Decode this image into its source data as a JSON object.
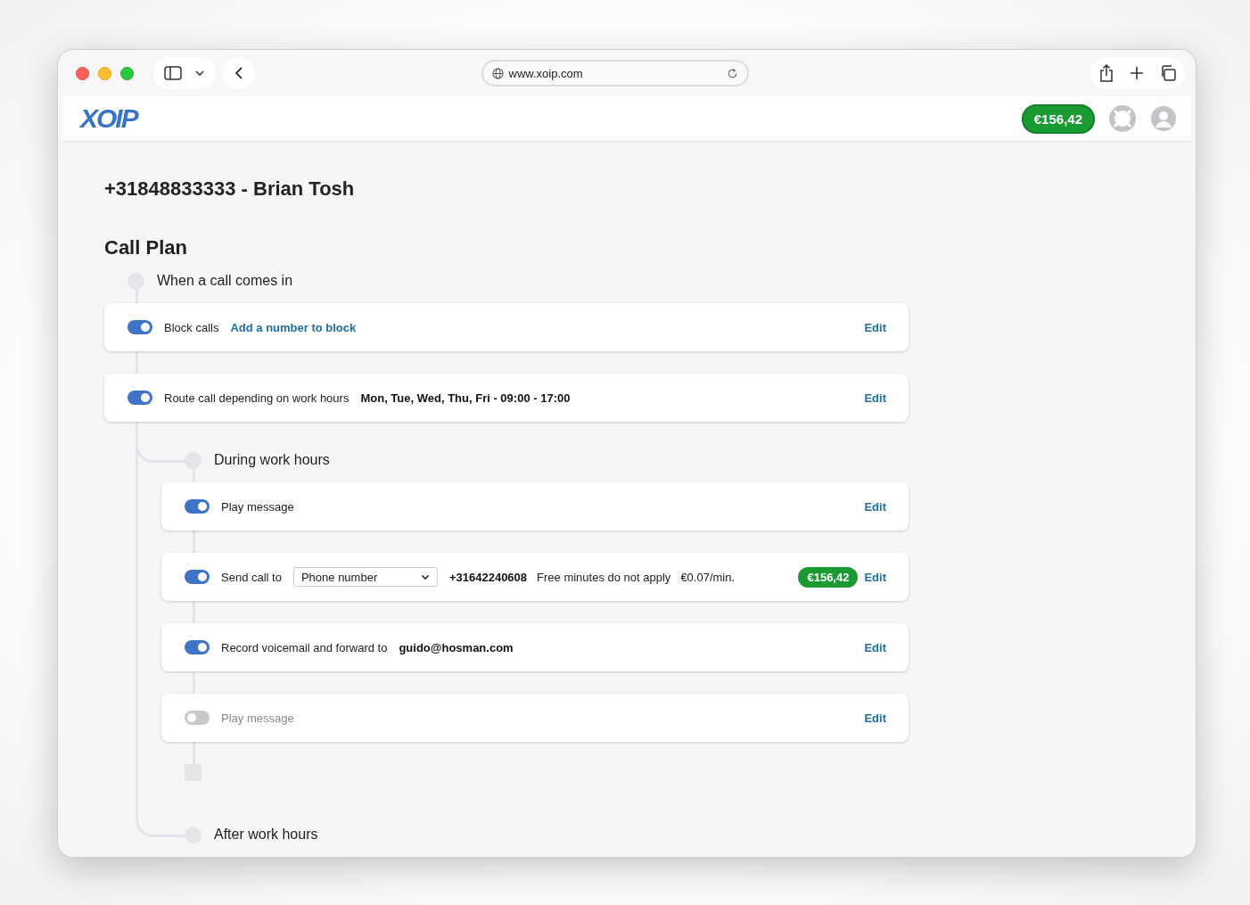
{
  "browser": {
    "url": "www.xoip.com"
  },
  "header": {
    "logo": "XOIP",
    "balance": "€156,42"
  },
  "title": "+31848833333 - Brian Tosh",
  "section": "Call Plan",
  "start": "When a call comes in",
  "steps": [
    {
      "on": true,
      "label": "Block calls",
      "link": "Add a number to block",
      "edit": "Edit"
    },
    {
      "on": true,
      "label": "Route call depending on work hours",
      "value": "Mon, Tue, Wed, Thu, Fri - 09:00 - 17:00",
      "edit": "Edit"
    }
  ],
  "branches": [
    {
      "label": "During work hours",
      "steps": [
        {
          "on": true,
          "label": "Play message",
          "edit": "Edit"
        },
        {
          "on": true,
          "label": "Send call to",
          "select": "Phone number",
          "value": "+31642240608",
          "notes": [
            "Free minutes do not apply",
            "€0.07/min."
          ],
          "badge": "€156,42",
          "edit": "Edit"
        },
        {
          "on": true,
          "label": "Record voicemail and forward to",
          "value": "guido@hosman.com",
          "edit": "Edit"
        },
        {
          "on": false,
          "label": "Play message",
          "edit": "Edit"
        }
      ]
    },
    {
      "label": "After work hours"
    }
  ]
}
